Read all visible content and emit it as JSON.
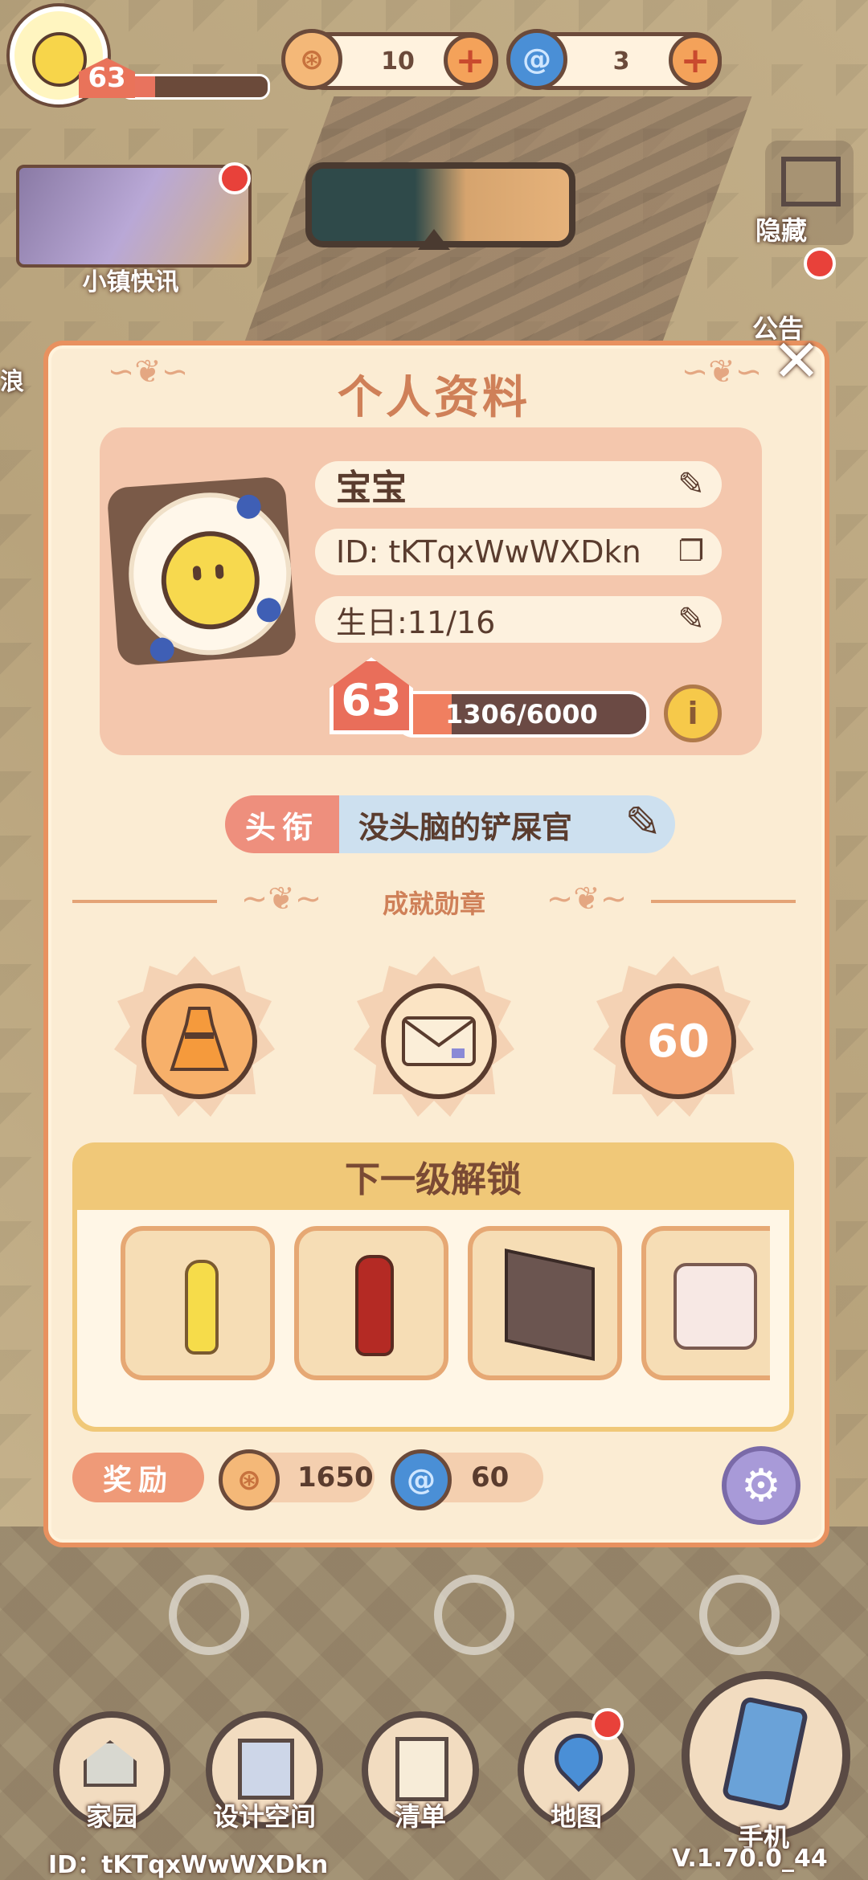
{
  "hud": {
    "level": "63",
    "xp_fraction": 0.22,
    "coins": "10",
    "gems": "3"
  },
  "news_label": "小镇快讯",
  "right_buttons": {
    "hide": "隐藏",
    "notice_partial": "公告",
    "left_partial": "浪"
  },
  "profile": {
    "title": "个人资料",
    "name": "宝宝",
    "id": "ID: tKTqxWwWXDkn",
    "birthday": "生日:11/16",
    "level": "63",
    "exp_text": "1306/6000",
    "exp_fraction": 0.218,
    "info_symbol": "i",
    "title_tag": "头衔",
    "title_value": "没头脑的铲屎官"
  },
  "achievements": {
    "label": "成就勋章",
    "badges": [
      {
        "name": "dress",
        "icon": "dress-icon"
      },
      {
        "name": "envelope",
        "icon": "envelope-icon"
      },
      {
        "name": "level-60",
        "text": "60",
        "icon": "level-60-icon"
      }
    ]
  },
  "unlock": {
    "title": "下一级解锁",
    "items": [
      {
        "icon": "lemon-soda-bottle-icon"
      },
      {
        "icon": "cola-bottle-icon"
      },
      {
        "icon": "wall-panel-icon"
      },
      {
        "icon": "white-cabinet-icon"
      }
    ]
  },
  "reward": {
    "label": "奖励",
    "coins": "1650",
    "gems": "60"
  },
  "nav": {
    "home": "家园",
    "design": "设计空间",
    "list": "清单",
    "map": "地图",
    "phone": "手机"
  },
  "footer": {
    "id": "ID：tKTqxWwWXDkn",
    "version": "V.1.70.0_44"
  },
  "colors": {
    "accent": "#e8915f",
    "panel_bg": "#fbecd3",
    "title_color": "#cf8058",
    "level_red": "#e96e5a"
  }
}
